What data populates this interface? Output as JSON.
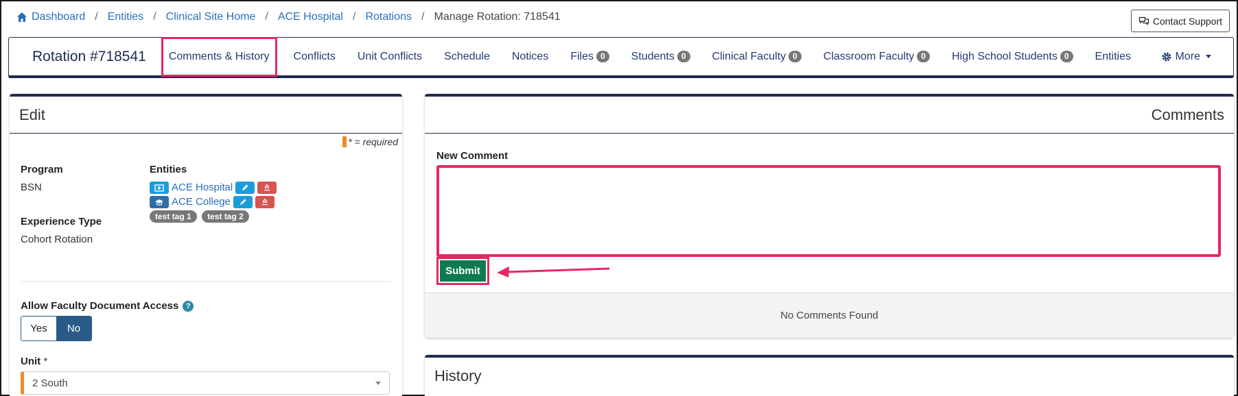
{
  "breadcrumb": {
    "items": [
      "Dashboard",
      "Entities",
      "Clinical Site Home",
      "ACE Hospital",
      "Rotations"
    ],
    "current": "Manage Rotation: 718541"
  },
  "support": {
    "label": "Contact Support"
  },
  "nav": {
    "title": "Rotation #718541",
    "items": [
      {
        "label": "Comments & History",
        "badge": null
      },
      {
        "label": "Conflicts",
        "badge": null
      },
      {
        "label": "Unit Conflicts",
        "badge": null
      },
      {
        "label": "Schedule",
        "badge": null
      },
      {
        "label": "Notices",
        "badge": null
      },
      {
        "label": "Files",
        "badge": "0"
      },
      {
        "label": "Students",
        "badge": "0"
      },
      {
        "label": "Clinical Faculty",
        "badge": "0"
      },
      {
        "label": "Classroom Faculty",
        "badge": "0"
      },
      {
        "label": "High School Students",
        "badge": "0"
      },
      {
        "label": "Entities",
        "badge": null
      }
    ],
    "more_label": "More"
  },
  "edit": {
    "title": "Edit",
    "required_note": "* = required",
    "program_label": "Program",
    "program_value": "BSN",
    "entities_label": "Entities",
    "entities": [
      {
        "name": "ACE Hospital",
        "icon": "hospital-icon"
      },
      {
        "name": "ACE College",
        "icon": "graduation-cap-icon"
      }
    ],
    "tags": [
      "test tag 1",
      "test tag 2"
    ],
    "experience_label": "Experience Type",
    "experience_value": "Cohort Rotation",
    "faculty_access_label": "Allow Faculty Document Access",
    "help": "?",
    "toggle_yes": "Yes",
    "toggle_no": "No",
    "toggle_selected": "No",
    "unit_label": "Unit",
    "unit_required": "*",
    "unit_value": "2 South"
  },
  "comments": {
    "title": "Comments",
    "new_comment_label": "New Comment",
    "textarea_value": "",
    "submit_label": "Submit",
    "empty_text": "No Comments Found"
  },
  "history": {
    "title": "History"
  },
  "colors": {
    "navy": "#1e2a50",
    "link": "#2a6ebb",
    "highlight": "#e6275f",
    "submit": "#0f7a52",
    "required": "#f08a24"
  }
}
